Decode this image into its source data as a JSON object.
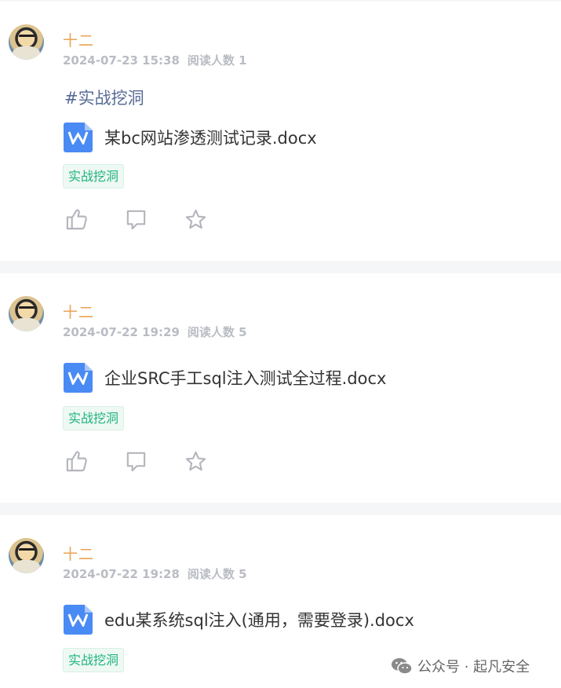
{
  "posts": [
    {
      "author": "十二",
      "date": "2024-07-23 15:38",
      "reads_label": "阅读人数 1",
      "hashtag": "#实战挖洞",
      "file_name": "某bc网站渗透测试记录.docx",
      "tag": "实战挖洞"
    },
    {
      "author": "十二",
      "date": "2024-07-22 19:29",
      "reads_label": "阅读人数 5",
      "file_name": "企业SRC手工sql注入测试全过程.docx",
      "tag": "实战挖洞"
    },
    {
      "author": "十二",
      "date": "2024-07-22 19:28",
      "reads_label": "阅读人数 5",
      "file_name": "edu某系统sql注入(通用，需要登录).docx",
      "tag": "实战挖洞"
    }
  ],
  "icons": {
    "like": "thumbs-up-icon",
    "comment": "comment-icon",
    "favorite": "star-icon",
    "doc": "word-doc-icon",
    "brand": "wechat-icon"
  },
  "colors": {
    "author": "#e9a352",
    "hashtag": "#576b95",
    "tag_text": "#20b37d",
    "doc_blue": "#4a8af4"
  },
  "watermark": "公众号 · 起凡安全"
}
